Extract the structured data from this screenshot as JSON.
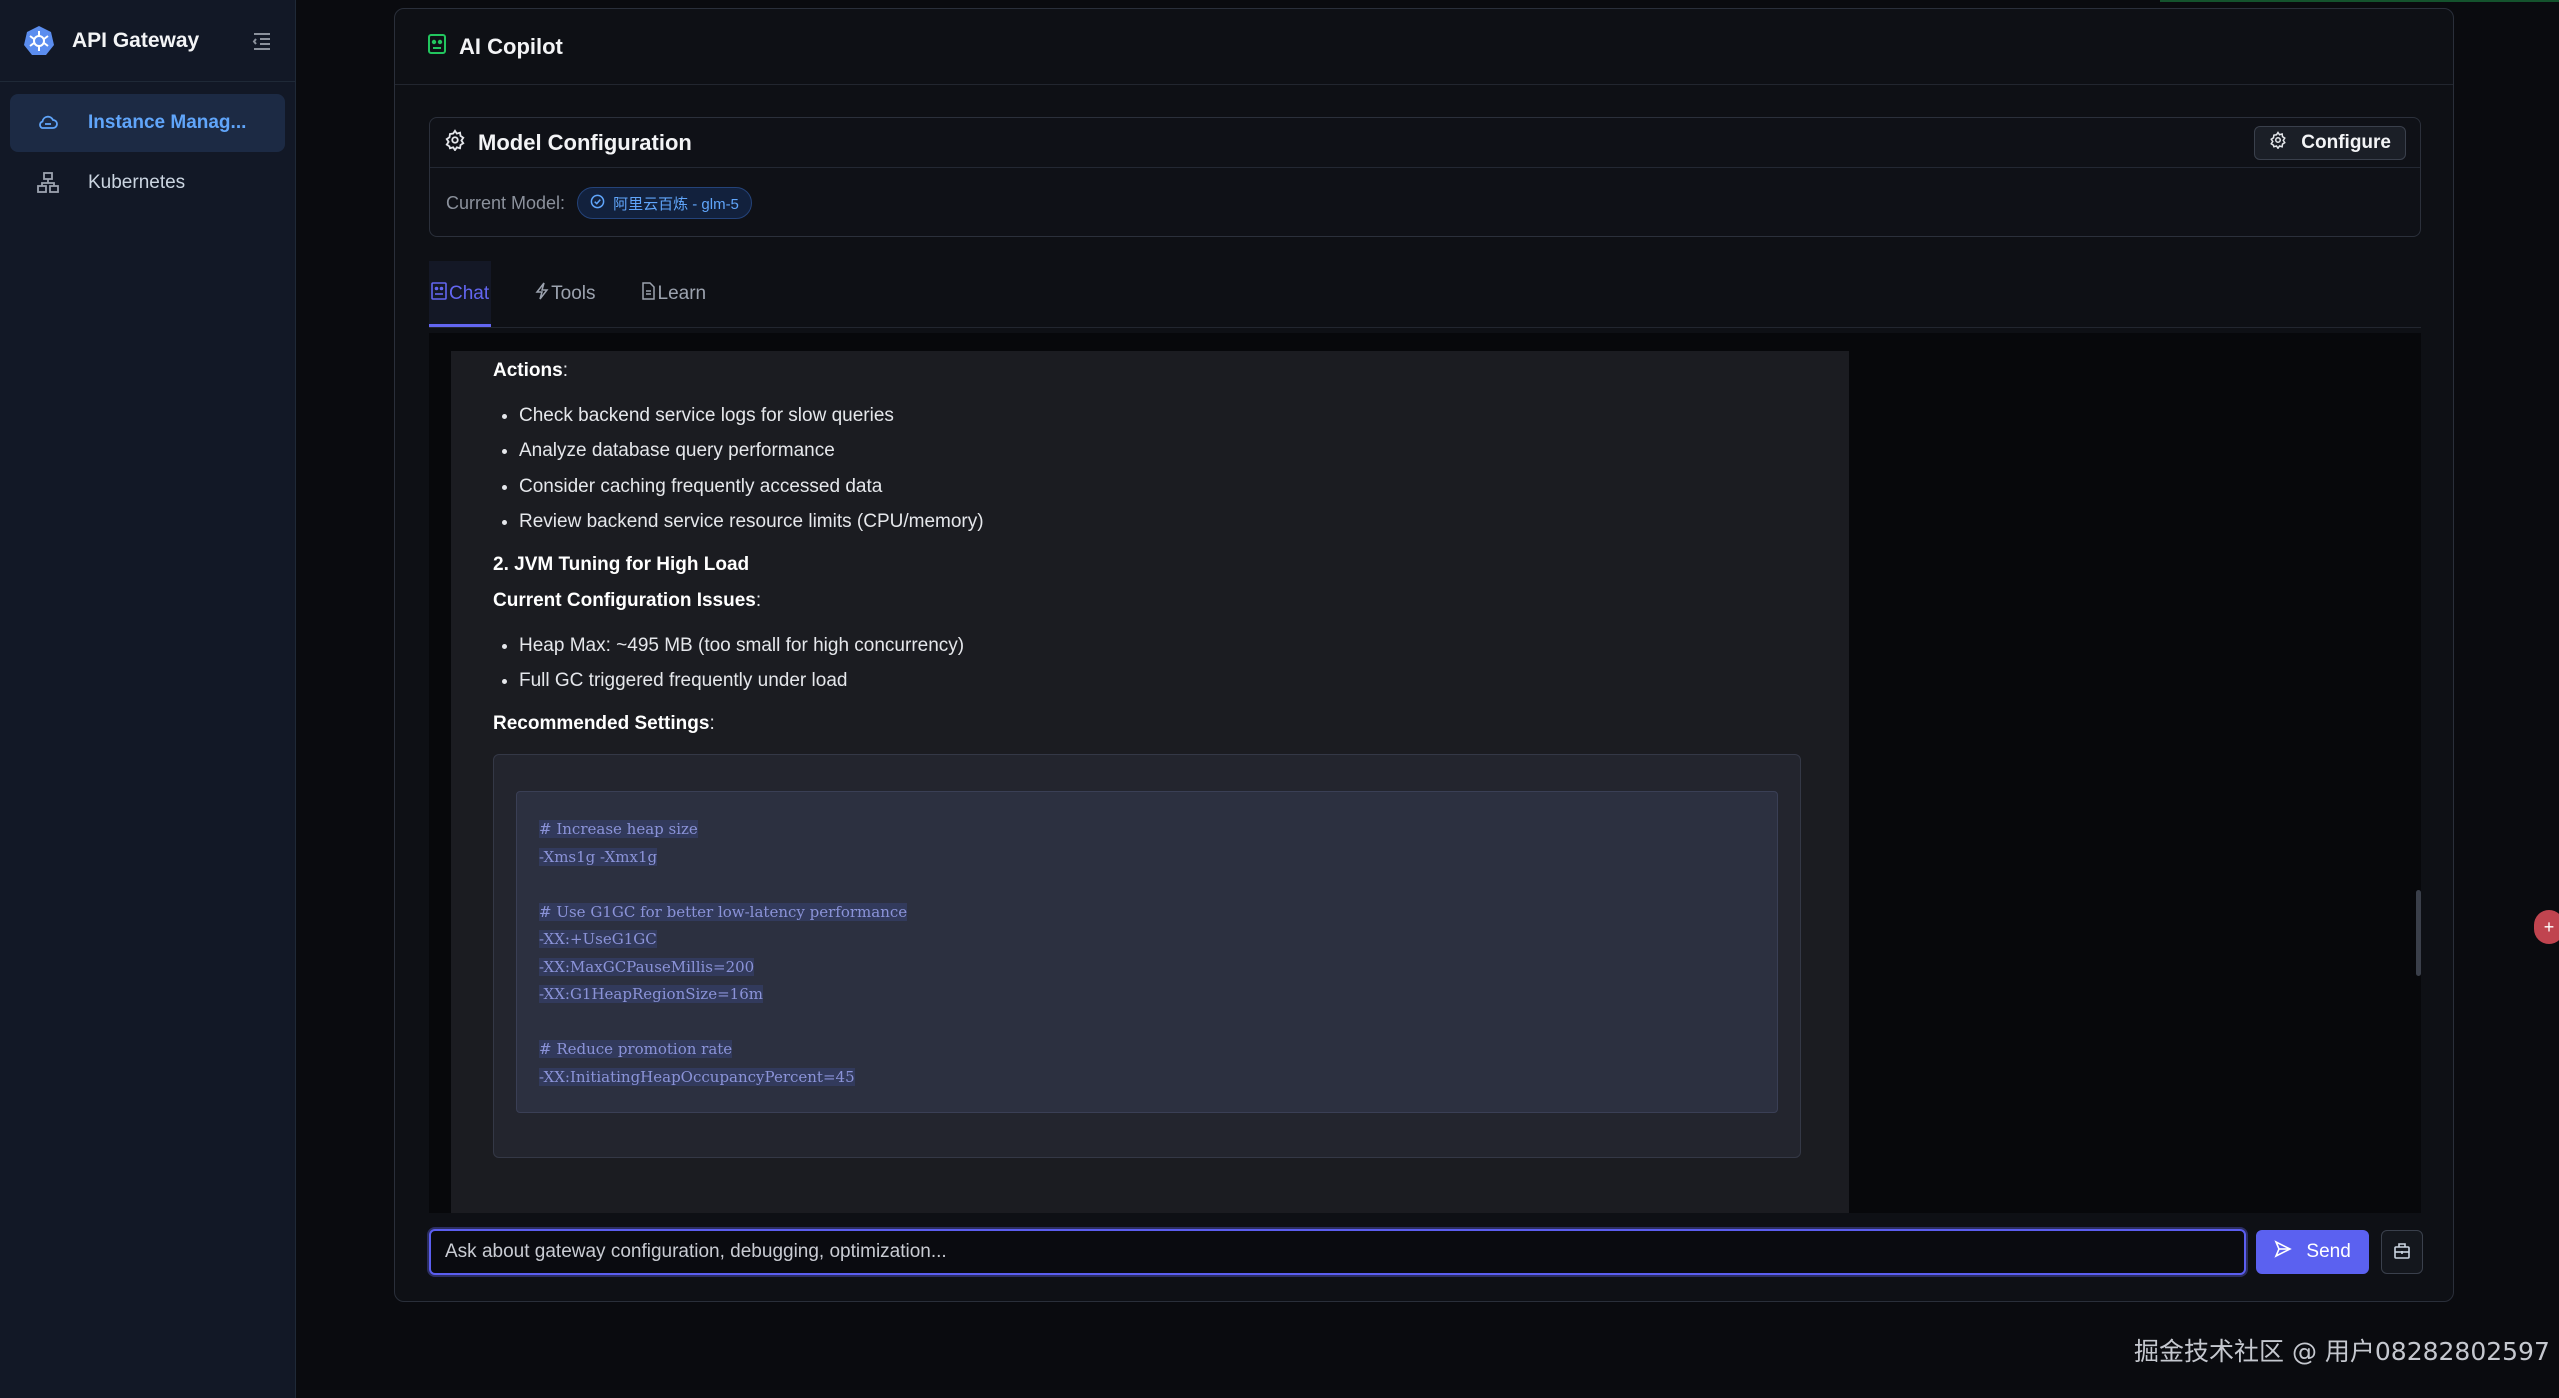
{
  "sidebar": {
    "brand": "API Gateway",
    "items": [
      {
        "label": "Instance Manag...",
        "active": true
      },
      {
        "label": "Kubernetes",
        "active": false
      }
    ]
  },
  "panel": {
    "title": "AI Copilot"
  },
  "model_config": {
    "title": "Model Configuration",
    "configure_label": "Configure",
    "current_model_label": "Current Model:",
    "current_model_value": "阿里云百炼 - glm-5"
  },
  "tabs": [
    {
      "label": "Chat",
      "active": true
    },
    {
      "label": "Tools",
      "active": false
    },
    {
      "label": "Learn",
      "active": false
    }
  ],
  "message": {
    "actions_heading": "Actions",
    "actions": [
      "Check backend service logs for slow queries",
      "Analyze database query performance",
      "Consider caching frequently accessed data",
      "Review backend service resource limits (CPU/memory)"
    ],
    "jvm_heading": "2. JVM Tuning for High Load",
    "issues_heading": "Current Configuration Issues",
    "issues": [
      "Heap Max: ~495 MB (too small for high concurrency)",
      "Full GC triggered frequently under load"
    ],
    "recommended_heading": "Recommended Settings",
    "code_lines": [
      "# Increase heap size",
      "-Xms1g -Xmx1g",
      "",
      "# Use G1GC for better low-latency performance",
      "-XX:+UseG1GC",
      "-XX:MaxGCPauseMillis=200",
      "-XX:G1HeapRegionSize=16m",
      "",
      "# Reduce promotion rate",
      "-XX:InitiatingHeapOccupancyPercent=45"
    ]
  },
  "input": {
    "placeholder": "Ask about gateway configuration, debugging, optimization...",
    "send_label": "Send"
  },
  "watermark": "掘金技术社区 @ 用户08282802597",
  "colors": {
    "accent": "#6366f1",
    "active_nav_text": "#60a5fa",
    "background": "#0a0b0f",
    "sidebar": "#121826"
  }
}
